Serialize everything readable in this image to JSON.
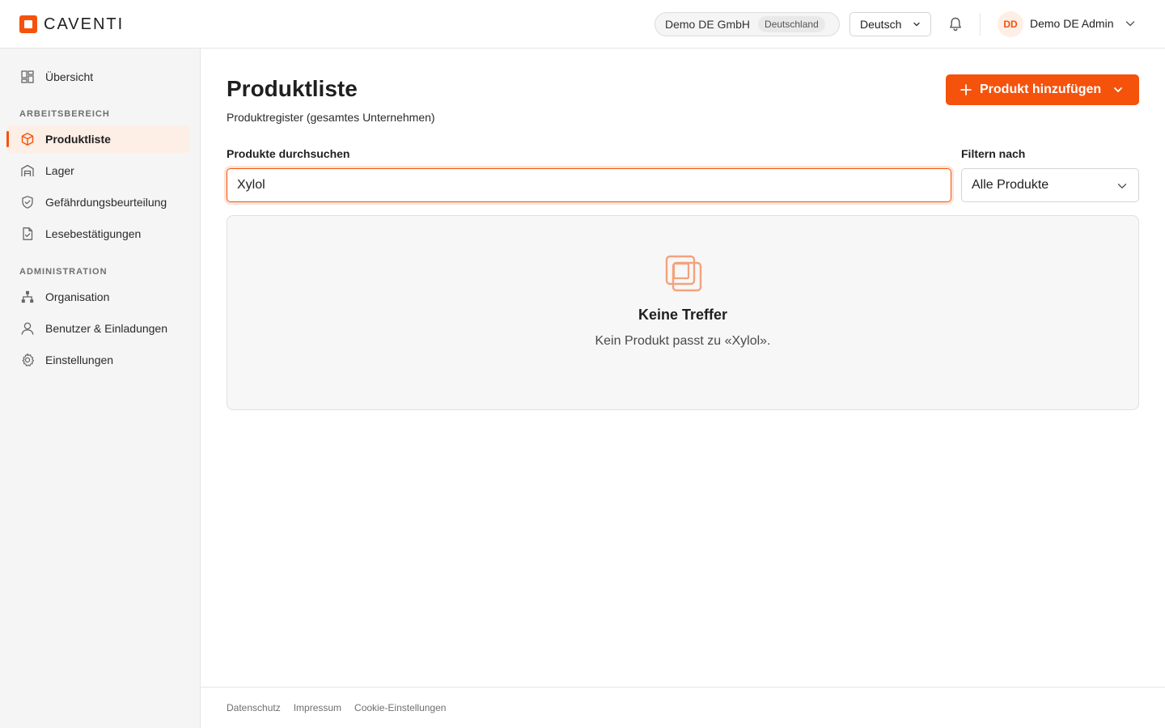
{
  "brand": {
    "name": "CAVENTI",
    "color": "#f5520c"
  },
  "header": {
    "company": "Demo DE GmbH",
    "country": "Deutschland",
    "language": "Deutsch",
    "user_initials": "DD",
    "user_name": "Demo DE Admin"
  },
  "sidebar": {
    "top_item": {
      "label": "Übersicht",
      "icon": "dashboard-icon"
    },
    "sections": [
      {
        "title": "ARBEITSBEREICH",
        "items": [
          {
            "label": "Produktliste",
            "icon": "box-icon",
            "active": true
          },
          {
            "label": "Lager",
            "icon": "warehouse-icon"
          },
          {
            "label": "Gefährdungsbeurteilung",
            "icon": "shield-icon"
          },
          {
            "label": "Lesebestätigungen",
            "icon": "document-check-icon"
          }
        ]
      },
      {
        "title": "ADMINISTRATION",
        "items": [
          {
            "label": "Organisation",
            "icon": "org-chart-icon"
          },
          {
            "label": "Benutzer & Einladungen",
            "icon": "user-icon"
          },
          {
            "label": "Einstellungen",
            "icon": "gear-icon"
          }
        ]
      }
    ]
  },
  "main": {
    "title": "Produktliste",
    "subtitle": "Produktregister (gesamtes Unternehmen)",
    "add_button": "Produkt hinzufügen",
    "search_label": "Produkte durchsuchen",
    "search_value": "Xylol",
    "filter_label": "Filtern nach",
    "filter_value": "Alle Produkte",
    "empty_title": "Keine Treffer",
    "empty_text": "Kein Produkt passt zu «Xylol»."
  },
  "footer": {
    "links": [
      "Datenschutz",
      "Impressum",
      "Cookie-Einstellungen"
    ]
  }
}
